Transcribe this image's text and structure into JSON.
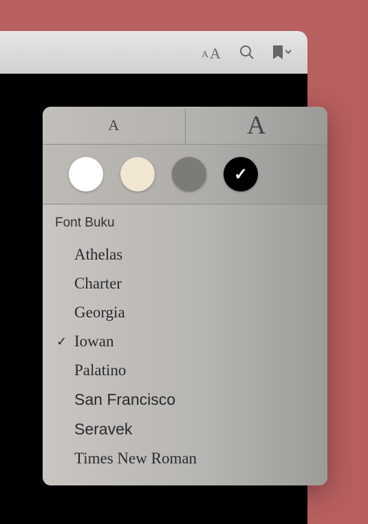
{
  "toolbar": {
    "appearance_icon": "appearance",
    "search_icon": "search",
    "bookmark_icon": "bookmark"
  },
  "popover": {
    "size": {
      "small_label": "A",
      "large_label": "A"
    },
    "themes": {
      "white": "#ffffff",
      "sepia": "#f0e6d2",
      "gray": "#7d7b77",
      "black": "#000000",
      "selected": "black"
    },
    "font_section_header": "Font Buku",
    "fonts": [
      {
        "name": "Athelas",
        "class": "font-athelas",
        "selected": false
      },
      {
        "name": "Charter",
        "class": "font-charter",
        "selected": false
      },
      {
        "name": "Georgia",
        "class": "font-georgia",
        "selected": false
      },
      {
        "name": "Iowan",
        "class": "font-iowan",
        "selected": true
      },
      {
        "name": "Palatino",
        "class": "font-palatino",
        "selected": false
      },
      {
        "name": "San Francisco",
        "class": "font-sanfrancisco",
        "selected": false
      },
      {
        "name": "Seravek",
        "class": "font-seravek",
        "selected": false
      },
      {
        "name": "Times New Roman",
        "class": "font-times",
        "selected": false
      }
    ]
  }
}
